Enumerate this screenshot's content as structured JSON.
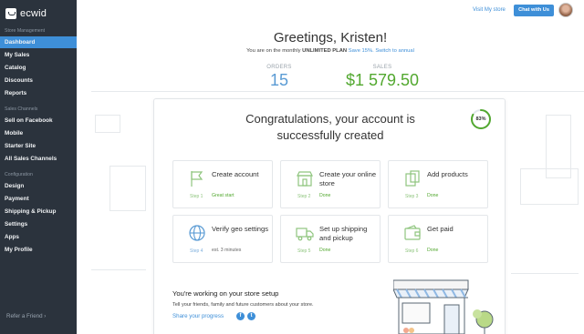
{
  "brand": {
    "logo_text": "ecwid"
  },
  "sidebar": {
    "sections": {
      "store_management": "Store Management",
      "sales_channels": "Sales Channels",
      "configuration": "Configuration"
    },
    "items": [
      {
        "label": "Dashboard",
        "active": true
      },
      {
        "label": "My Sales"
      },
      {
        "label": "Catalog"
      },
      {
        "label": "Discounts"
      },
      {
        "label": "Reports"
      },
      {
        "label": "Sell on Facebook"
      },
      {
        "label": "Mobile"
      },
      {
        "label": "Starter Site"
      },
      {
        "label": "All Sales Channels"
      },
      {
        "label": "Design"
      },
      {
        "label": "Payment"
      },
      {
        "label": "Shipping & Pickup"
      },
      {
        "label": "Settings"
      },
      {
        "label": "Apps"
      },
      {
        "label": "My Profile"
      }
    ],
    "refer_label": "Refer a Friend"
  },
  "header": {
    "visit_store": "Visit My store",
    "chat": "Chat with Us",
    "avatar_icon": "user-avatar"
  },
  "main": {
    "greeting": "Greetings, Kristen!",
    "plan_prefix": "You are on the monthly",
    "plan_name": "UNLIMITED PLAN",
    "plan_offer": "Save 15%. Switch to annual",
    "orders_label": "ORDERS",
    "orders_value": "15",
    "sales_label": "SALES",
    "sales_value": "$1 579.50"
  },
  "card": {
    "congrats_line1": "Congratulations, your account is",
    "congrats_line2": "successfully created",
    "progress": "83%",
    "progress_value": 0.83,
    "steps": [
      {
        "title": "Create account",
        "num": "Step 1",
        "status": "Great start",
        "icon": "flag-icon"
      },
      {
        "title": "Create your online store",
        "num": "Step 2",
        "status": "Done",
        "icon": "storefront-icon"
      },
      {
        "title": "Add products",
        "num": "Step 3",
        "status": "Done",
        "icon": "product-icon"
      },
      {
        "title": "Verify geo settings",
        "num": "Step 4",
        "status": "est. 3 minutes",
        "icon": "globe-icon"
      },
      {
        "title": "Set up shipping and pickup",
        "num": "Step 5",
        "status": "Done",
        "icon": "truck-icon"
      },
      {
        "title": "Get paid",
        "num": "Step 6",
        "status": "Done",
        "icon": "wallet-icon"
      }
    ],
    "setup_title": "You're working on your store setup",
    "setup_desc": "Tell your friends, family and future customers about your store.",
    "share_label": "Share your progress",
    "social_facebook": "f",
    "social_twitter": "t"
  },
  "colors": {
    "sidebar_bg": "#2b333d",
    "accent": "#3e8fd8",
    "success": "#52a82f"
  }
}
